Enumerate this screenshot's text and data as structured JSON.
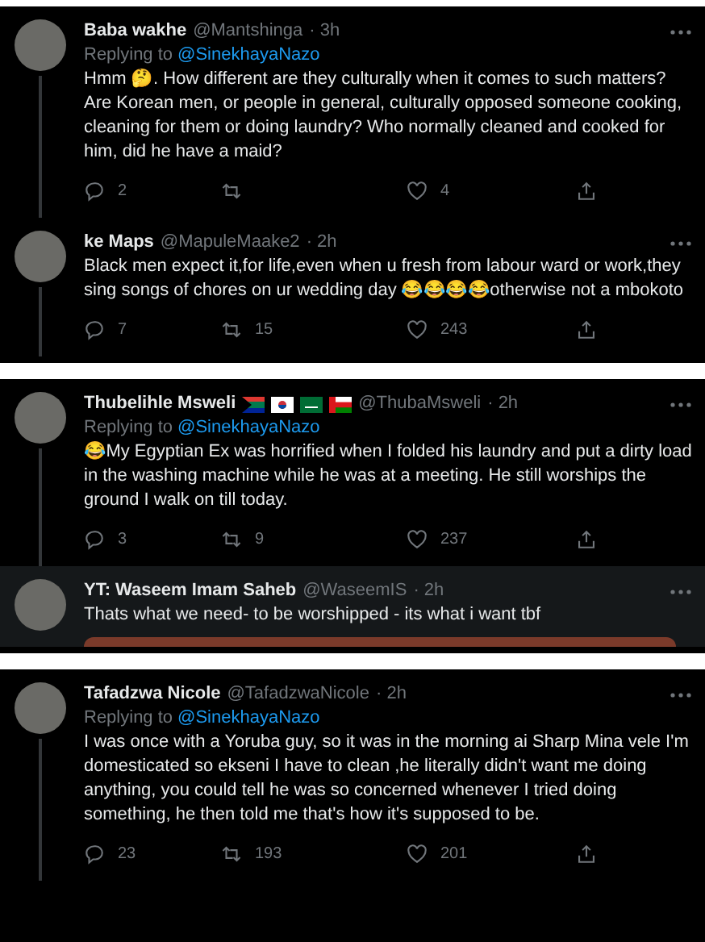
{
  "panels": [
    {
      "tweets": [
        {
          "name": "Baba wakhe",
          "handle": "@Mantshinga",
          "time": "· 3h",
          "replying_label": "Replying to",
          "replying_to": "@SinekhayaNazo",
          "thread_line": true,
          "highlighted": false,
          "text": "Hmm 🤔. How different are they culturally when it comes to such matters? Are Korean men, or people in general, culturally opposed someone cooking, cleaning for them or doing laundry? Who normally cleaned and cooked for him, did he have a maid?",
          "reply": "2",
          "like": "4"
        },
        {
          "name": "ke Maps",
          "handle": "@MapuleMaake2",
          "time": "· 2h",
          "thread_line": true,
          "highlighted": false,
          "text": "Black men expect it,for life,even when u fresh from labour ward or work,they sing songs of chores on ur wedding day 😂😂😂😂otherwise not a mbokoto",
          "reply": "7",
          "retweet": "15",
          "like": "243"
        }
      ]
    },
    {
      "tweets": [
        {
          "name": "Thubelihle Msweli",
          "flags": [
            {
              "kind": "za"
            },
            {
              "kind": "kr"
            },
            {
              "kind": "sa"
            },
            {
              "kind": "om"
            }
          ],
          "handle": "@ThubaMsweli",
          "time": "· 2h",
          "replying_label": "Replying to",
          "replying_to": "@SinekhayaNazo",
          "thread_line": true,
          "highlighted": false,
          "text": "😂My Egyptian Ex was horrified when I folded his laundry and put a dirty load in the washing machine while he was at a meeting. He still worships the ground I walk on till today.",
          "reply": "3",
          "retweet": "9",
          "like": "237"
        },
        {
          "name": "YT: Waseem Imam Saheb",
          "handle": "@WaseemIS",
          "time": "· 2h",
          "thread_line": false,
          "highlighted": true,
          "photo": true,
          "text": "Thats what we need- to be worshipped - its what i want tbf"
        }
      ]
    },
    {
      "tweets": [
        {
          "name": "Tafadzwa Nicole",
          "handle": "@TafadzwaNicole",
          "time": "· 2h",
          "replying_label": "Replying to",
          "replying_to": "@SinekhayaNazo",
          "thread_line": true,
          "highlighted": false,
          "text": "I was once with a Yoruba guy, so it was in the morning ai Sharp Mina vele I'm domesticated so ekseni I have to clean ,he literally didn't want me doing anything, you could tell he was so concerned whenever I tried doing something, he then told me that's how it's supposed to be.",
          "reply": "23",
          "retweet": "193",
          "like": "201"
        }
      ]
    }
  ]
}
